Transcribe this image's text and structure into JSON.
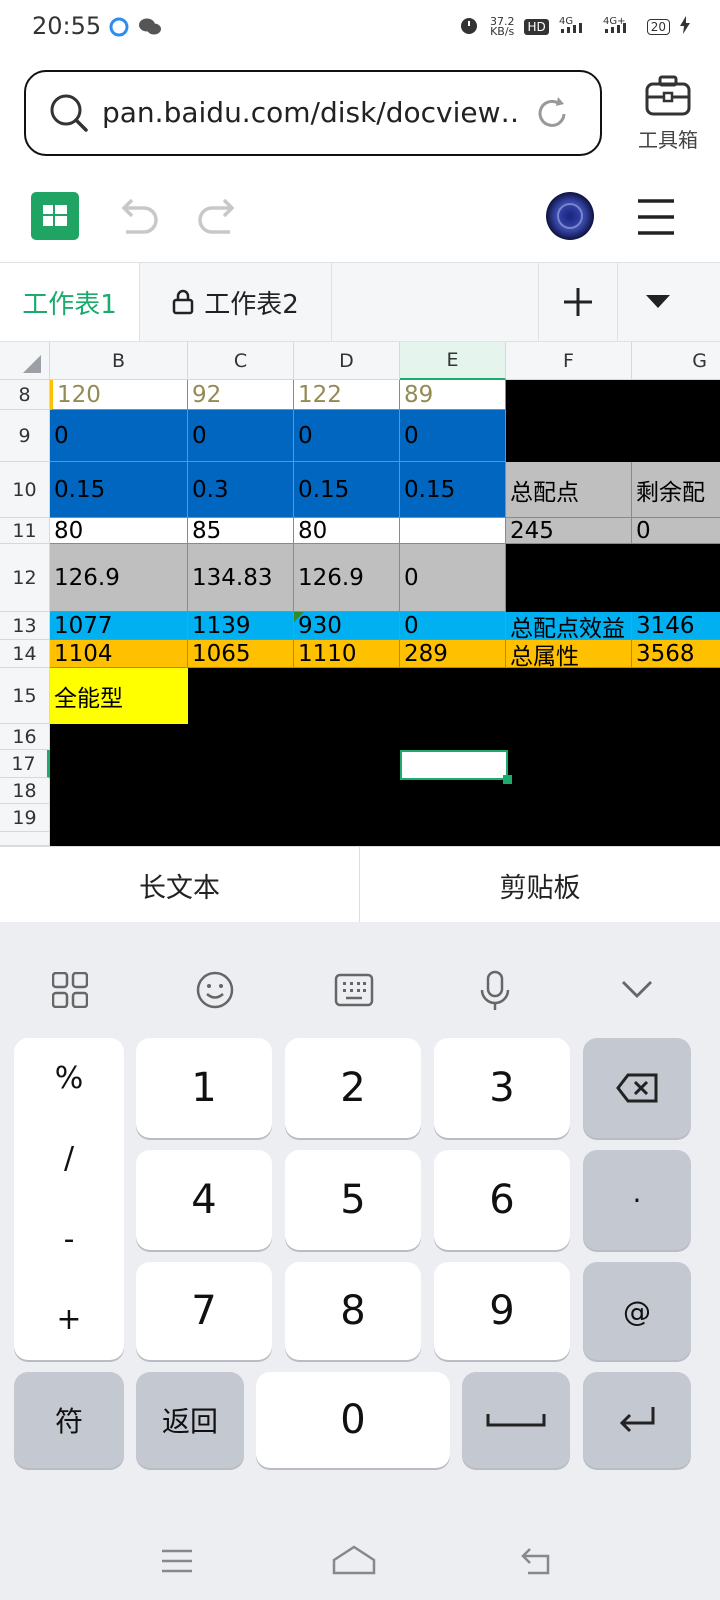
{
  "status": {
    "time": "20:55",
    "speed": "37.2",
    "speed_unit": "KB/s",
    "battery": "20"
  },
  "browser": {
    "url": "pan.baidu.com/disk/docview…",
    "toolbox_label": "工具箱"
  },
  "sheets": {
    "tab1": "工作表1",
    "tab2": "工作表2"
  },
  "grid": {
    "columns": [
      "B",
      "C",
      "D",
      "E",
      "F",
      "G"
    ],
    "rows": [
      "8",
      "9",
      "10",
      "11",
      "12",
      "13",
      "14",
      "15",
      "16",
      "17",
      "18",
      "19"
    ],
    "cells": {
      "r8": [
        "120",
        "92",
        "122",
        "89"
      ],
      "r9": [
        "0",
        "0",
        "0",
        "0"
      ],
      "r10": [
        "0.15",
        "0.3",
        "0.15",
        "0.15",
        "总配点",
        "剩余配"
      ],
      "r11": [
        "80",
        "85",
        "80",
        "",
        "245",
        "0"
      ],
      "r12": [
        "126.9",
        "134.83",
        "126.9",
        "0"
      ],
      "r13": [
        "1077",
        "1139",
        "930",
        "0",
        "总配点效益",
        "3146"
      ],
      "r14": [
        "1104",
        "1065",
        "1110",
        "289",
        "总属性",
        "3568"
      ],
      "r15": [
        "全能型"
      ]
    },
    "colors": {
      "blue": "#0066c0",
      "cyan": "#00b0f0",
      "orange": "#ffc000",
      "yellow": "#ffff00",
      "gray": "#bfbfbf",
      "black": "#000000",
      "olive": "#948a54",
      "accent": "#1aab6d"
    }
  },
  "quickbar": {
    "long_text": "长文本",
    "clipboard": "剪贴板"
  },
  "keyboard": {
    "left_col": [
      "%",
      "/",
      "-",
      "+"
    ],
    "digits": [
      "1",
      "2",
      "3",
      "4",
      "5",
      "6",
      "7",
      "8",
      "9",
      "0"
    ],
    "dot": "·",
    "at": "@",
    "symbols": "符",
    "back": "返回"
  }
}
